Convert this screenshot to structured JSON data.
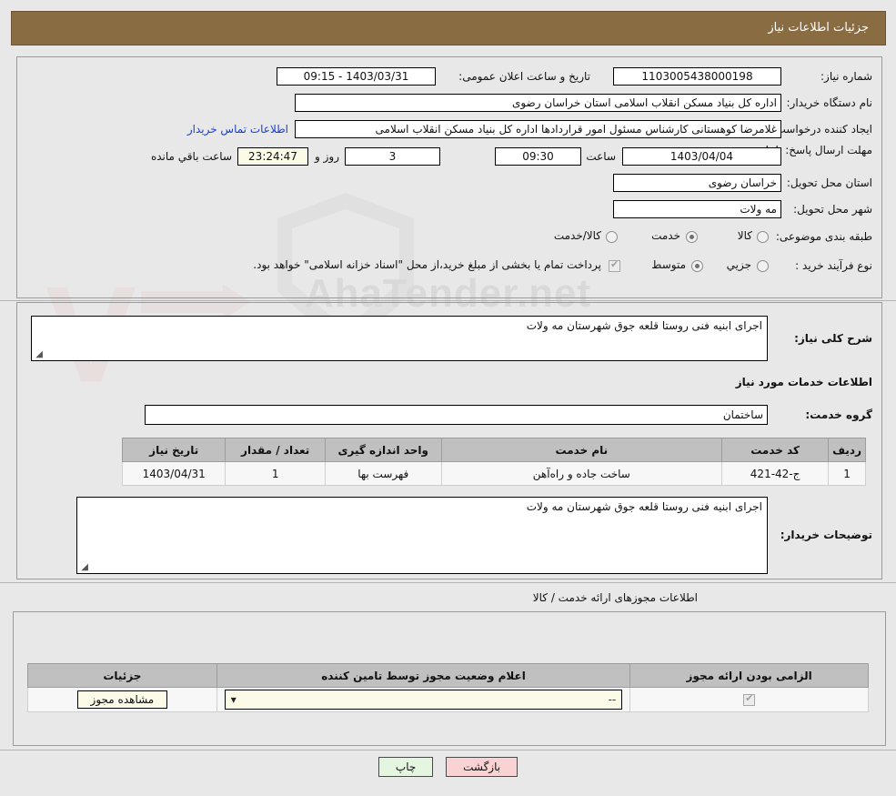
{
  "header": {
    "title": "جزئیات اطلاعات نیاز"
  },
  "watermark": {
    "text": "AhaTender.net"
  },
  "info": {
    "need_number_label": "شماره نیاز:",
    "need_number": "1103005438000198",
    "announce_label": "تاریخ و ساعت اعلان عمومی:",
    "announce_value": "1403/03/31 - 09:15",
    "buyer_org_label": "نام دستگاه خریدار:",
    "buyer_org": "اداره کل بنیاد مسکن انقلاب اسلامی استان خراسان رضوی",
    "requester_label": "ایجاد کننده درخواست:",
    "requester": "غلامرضا کوهستانی کارشناس مسئول امور قراردادها اداره کل بنیاد مسکن انقلاب اسلامی",
    "contact_link": "اطلاعات تماس خریدار",
    "deadline_label": "مهلت ارسال پاسخ: تا تاریخ:",
    "deadline_date": "1403/04/04",
    "time_label": "ساعت",
    "deadline_time": "09:30",
    "days_remaining": "3",
    "days_unit_label": "روز و",
    "countdown": "23:24:47",
    "countdown_unit_label": "ساعت باقي مانده",
    "province_label": "استان محل تحویل:",
    "province": "خراسان رضوی",
    "city_label": "شهر محل تحویل:",
    "city": "مه ولات",
    "category_label": "طبقه بندی موضوعی:",
    "category_options": [
      "کالا",
      "خدمت",
      "کالا/خدمت"
    ],
    "category_selected": "خدمت",
    "process_label": "نوع فرآیند خرید :",
    "process_options": [
      "جزیي",
      "متوسط"
    ],
    "process_selected": "متوسط",
    "treasury_note": "پرداخت تمام یا بخشی از مبلغ خرید،از محل \"اسناد خزانه اسلامی\" خواهد بود."
  },
  "description": {
    "summary_label": "شرح کلی نیاز:",
    "summary_value": "اجرای ابنیه فنی روستا قلعه جوق شهرستان مه ولات",
    "services_section_title": "اطلاعات خدمات مورد نیاز",
    "service_group_label": "گروه خدمت:",
    "service_group_value": "ساختمان"
  },
  "services_table": {
    "columns": [
      "ردیف",
      "کد خدمت",
      "نام خدمت",
      "واحد اندازه گیری",
      "تعداد / مقدار",
      "تاریخ نیاز"
    ],
    "rows": [
      {
        "index": "1",
        "code": "ج-42-421",
        "name": "ساخت جاده و راه‌آهن",
        "unit": "فهرست بها",
        "quantity": "1",
        "date": "1403/04/31"
      }
    ]
  },
  "buyer_notes": {
    "label": "توضیحات خریدار:",
    "value": "اجرای ابنیه فنی روستا قلعه جوق شهرستان مه ولات"
  },
  "permits": {
    "section_title": "اطلاعات مجوزهای ارائه خدمت / کالا",
    "columns": [
      "الزامی بودن ارائه مجوز",
      "اعلام وضعیت مجوز توسط تامین کننده",
      "جزئیات"
    ],
    "rows": [
      {
        "required_checked": true,
        "status_value": "--",
        "details_button": "مشاهده مجوز"
      }
    ]
  },
  "footer": {
    "print_label": "چاپ",
    "back_label": "بازگشت"
  },
  "colors": {
    "header_bg": "#8a6c43",
    "link": "#1a3fd4",
    "print_button": "#e4f5e0",
    "back_button": "#f9d3d3",
    "field_khaki": "#fbfbe8"
  }
}
